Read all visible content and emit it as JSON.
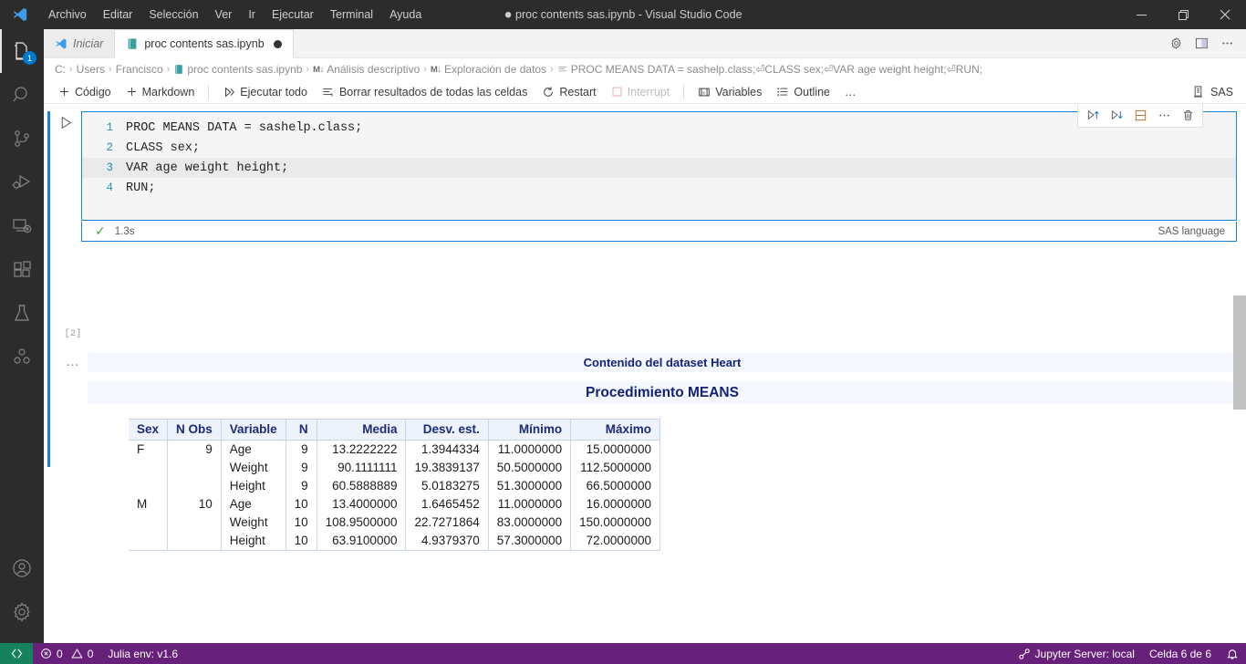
{
  "titlebar": {
    "menus": [
      "Archivo",
      "Editar",
      "Selección",
      "Ver",
      "Ir",
      "Ejecutar",
      "Terminal",
      "Ayuda"
    ],
    "window_title": "proc contents sas.ipynb - Visual Studio Code",
    "dirty_marker": "●",
    "controls": {
      "minimize": "minimize-icon",
      "maximize": "restore-icon",
      "close": "close-icon"
    }
  },
  "activitybar": {
    "items": [
      {
        "name": "explorer",
        "icon": "files-icon",
        "badge": "1",
        "active": true
      },
      {
        "name": "search",
        "icon": "search-icon",
        "badge": "",
        "active": false
      },
      {
        "name": "source-control",
        "icon": "source-control-icon",
        "badge": "",
        "active": false
      },
      {
        "name": "run-debug",
        "icon": "run-and-debug-icon",
        "badge": "",
        "active": false
      },
      {
        "name": "remote-explorer",
        "icon": "remote-explorer-icon",
        "badge": "",
        "active": false
      },
      {
        "name": "extensions",
        "icon": "extensions-icon",
        "badge": "",
        "active": false
      },
      {
        "name": "testing",
        "icon": "beaker-icon",
        "badge": "",
        "active": false
      },
      {
        "name": "jupyter",
        "icon": "jupyter-variables-icon",
        "badge": "",
        "active": false
      }
    ],
    "bottom": [
      {
        "name": "accounts",
        "icon": "account-icon"
      },
      {
        "name": "settings",
        "icon": "gear-icon"
      }
    ]
  },
  "tabs": [
    {
      "label": "Iniciar",
      "icon": "vscode-logo-icon",
      "active": false,
      "dirty": false
    },
    {
      "label": "proc contents sas.ipynb",
      "icon": "notebook-icon",
      "active": true,
      "dirty": true
    }
  ],
  "tab_actions": [
    {
      "name": "settings-gear",
      "icon": "gear-icon"
    },
    {
      "name": "split-editor",
      "icon": "split-editor-icon"
    },
    {
      "name": "more-actions",
      "icon": "ellipsis-icon"
    }
  ],
  "breadcrumb": {
    "items": [
      {
        "label": "C:",
        "icon": ""
      },
      {
        "label": "Users",
        "icon": ""
      },
      {
        "label": "Francisco",
        "icon": ""
      },
      {
        "label": "proc contents sas.ipynb",
        "icon": "notebook-icon"
      },
      {
        "label": "Análisis descriptivo",
        "icon": "markdown-cell-icon"
      },
      {
        "label": "Exploración de datos",
        "icon": "markdown-cell-icon"
      },
      {
        "label": "PROC MEANS DATA = sashelp.class;⏎CLASS sex;⏎VAR age weight height;⏎RUN;",
        "icon": "code-cell-icon"
      }
    ],
    "separator": "›"
  },
  "notebook_toolbar": {
    "buttons": [
      {
        "label": "Código",
        "icon": "plus-icon",
        "disabled": false
      },
      {
        "label": "Markdown",
        "icon": "plus-icon",
        "disabled": false
      },
      {
        "label": "Ejecutar todo",
        "icon": "run-all-icon",
        "disabled": false
      },
      {
        "label": "Borrar resultados de todas las celdas",
        "icon": "clear-outputs-icon",
        "disabled": false
      },
      {
        "label": "Restart",
        "icon": "restart-icon",
        "disabled": false
      },
      {
        "label": "Interrupt",
        "icon": "interrupt-icon",
        "disabled": true
      },
      {
        "label": "Variables",
        "icon": "variables-icon",
        "disabled": false
      },
      {
        "label": "Outline",
        "icon": "outline-icon",
        "disabled": false
      },
      {
        "label": "…",
        "icon": "ellipsis-icon",
        "disabled": false
      }
    ],
    "kernel": {
      "label": "SAS",
      "icon": "kernel-icon"
    }
  },
  "cell": {
    "execution_count": "[2]",
    "status_time": "1.3s",
    "status_icon": "check-icon",
    "language": "SAS language",
    "run_button": "run-cell-icon",
    "output_dots": "…",
    "lines": [
      {
        "no": "1",
        "parts": [
          {
            "t": "PROC MEANS ",
            "k": false
          },
          {
            "t": "DATA",
            "k": true
          },
          {
            "t": " = sashelp.class;",
            "k": false
          }
        ],
        "highlight": false
      },
      {
        "no": "2",
        "parts": [
          {
            "t": "CLASS sex;",
            "k": false
          }
        ],
        "highlight": false
      },
      {
        "no": "3",
        "parts": [
          {
            "t": "VAR age weight height;",
            "k": false
          }
        ],
        "highlight": true
      },
      {
        "no": "4",
        "parts": [
          {
            "t": "RUN",
            "k": true
          },
          {
            "t": ";",
            "k": false
          }
        ],
        "highlight": false
      }
    ],
    "toolbar": [
      {
        "name": "run-above",
        "icon": "run-above-icon"
      },
      {
        "name": "run-below",
        "icon": "run-below-icon"
      },
      {
        "name": "split-cell",
        "icon": "split-cell-icon"
      },
      {
        "name": "more-cell-actions",
        "icon": "ellipsis-icon"
      },
      {
        "name": "delete-cell",
        "icon": "trash-icon"
      }
    ]
  },
  "output": {
    "title_1": "Contenido del dataset Heart",
    "title_2": "Procedimiento MEANS",
    "table": {
      "headers": [
        "Sex",
        "N Obs",
        "Variable",
        "N",
        "Media",
        "Desv. est.",
        "Mínimo",
        "Máximo"
      ],
      "header_align": [
        "l",
        "r",
        "l",
        "r",
        "r",
        "r",
        "r",
        "r"
      ],
      "rows": [
        {
          "sex": "F",
          "nobs": "9",
          "variable": "Age",
          "n": "9",
          "media": "13.2222222",
          "desv": "1.3944334",
          "min": "11.0000000",
          "max": "15.0000000"
        },
        {
          "sex": "",
          "nobs": "",
          "variable": "Weight",
          "n": "9",
          "media": "90.1111111",
          "desv": "19.3839137",
          "min": "50.5000000",
          "max": "112.5000000"
        },
        {
          "sex": "",
          "nobs": "",
          "variable": "Height",
          "n": "9",
          "media": "60.5888889",
          "desv": "5.0183275",
          "min": "51.3000000",
          "max": "66.5000000"
        },
        {
          "sex": "M",
          "nobs": "10",
          "variable": "Age",
          "n": "10",
          "media": "13.4000000",
          "desv": "1.6465452",
          "min": "11.0000000",
          "max": "16.0000000"
        },
        {
          "sex": "",
          "nobs": "",
          "variable": "Weight",
          "n": "10",
          "media": "108.9500000",
          "desv": "22.7271864",
          "min": "83.0000000",
          "max": "150.0000000"
        },
        {
          "sex": "",
          "nobs": "",
          "variable": "Height",
          "n": "10",
          "media": "63.9100000",
          "desv": "4.9379370",
          "min": "57.3000000",
          "max": "72.0000000"
        }
      ]
    }
  },
  "statusbar": {
    "remote_icon": "remote-indicator-icon",
    "errors": "0",
    "warnings": "0",
    "env": "Julia env: v1.6",
    "jupyter_server": "Jupyter Server: local",
    "cell_position": "Celda 6 de 6",
    "bell_icon": "bell-icon"
  },
  "colors": {
    "accent": "#007acc",
    "cell_focus": "#1b80d8",
    "statusbar": "#68217a",
    "remote_green": "#16825d",
    "sas_heading": "#112277",
    "keyword": "#0000ff"
  }
}
